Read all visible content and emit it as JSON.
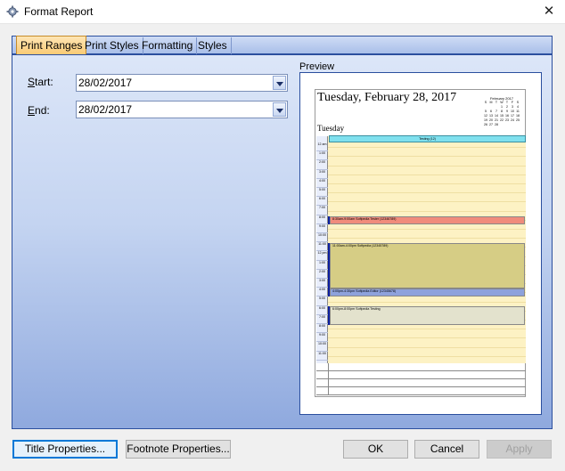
{
  "window": {
    "title": "Format Report",
    "close_glyph": "✕",
    "icon": "gear-icon"
  },
  "tabs": [
    {
      "label": "Print Ranges",
      "active": true
    },
    {
      "label": "Print Styles",
      "active": false
    },
    {
      "label": "Formatting",
      "active": false
    },
    {
      "label": "Styles",
      "active": false
    }
  ],
  "form": {
    "start_label_key": "S",
    "start_label_rest": "tart:",
    "start_value": "28/02/2017",
    "end_label_key": "E",
    "end_label_rest": "nd:",
    "end_value": "28/02/2017"
  },
  "preview": {
    "label": "Preview",
    "date_heading": "Tuesday, February 28, 2017",
    "day_name": "Tuesday",
    "mini_calendar": {
      "title": "February 2017",
      "weekdays": [
        "S",
        "M",
        "T",
        "W",
        "T",
        "F",
        "S"
      ],
      "weeks": [
        [
          "",
          "",
          "",
          "1",
          "2",
          "3",
          "4"
        ],
        [
          "5",
          "6",
          "7",
          "8",
          "9",
          "10",
          "11"
        ],
        [
          "12",
          "13",
          "14",
          "15",
          "16",
          "17",
          "18"
        ],
        [
          "19",
          "20",
          "21",
          "22",
          "23",
          "24",
          "25"
        ],
        [
          "26",
          "27",
          "28",
          "",
          "",
          "",
          ""
        ]
      ]
    },
    "all_day_event": "Testing (12)",
    "times": [
      "12 am",
      "1:00",
      "2:00",
      "3:00",
      "4:00",
      "5:00",
      "6:00",
      "7:00",
      "8:00",
      "9:00",
      "10:00",
      "11:00",
      "12 pm",
      "1:00",
      "2:00",
      "3:00",
      "4:00",
      "5:00",
      "6:00",
      "7:00",
      "8:00",
      "9:00",
      "10:00",
      "11:00"
    ],
    "appointments": [
      {
        "text": "8:30am-9:00am Softpedia Tester (12346789)",
        "color": "#f08c7c"
      },
      {
        "text": "11:00am-4:00pm Softpedia (12345789)",
        "color": "#d6cd85"
      },
      {
        "text": "4:00pm-4:30pm Softpedia Editor (12345678)",
        "color": "#8ea2dc"
      },
      {
        "text": "6:00pm-8:00pm Softpedia Testing",
        "color": "#e3e2cd"
      }
    ]
  },
  "buttons": {
    "title_properties": "Title Properties...",
    "footnote_properties": "Footnote Properties...",
    "ok": "OK",
    "cancel": "Cancel",
    "apply": "Apply"
  }
}
